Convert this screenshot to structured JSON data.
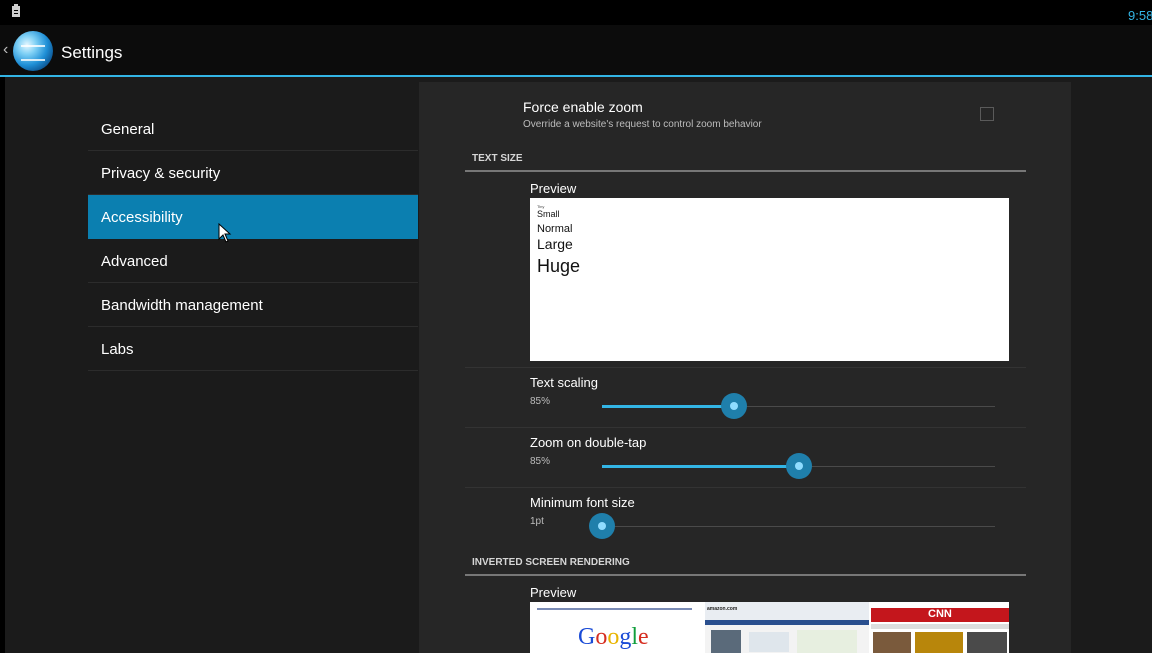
{
  "status_bar": {
    "clock": "9:58"
  },
  "action_bar": {
    "title": "Settings"
  },
  "nav": {
    "items": [
      {
        "label": "General",
        "selected": false
      },
      {
        "label": "Privacy & security",
        "selected": false
      },
      {
        "label": "Accessibility",
        "selected": true
      },
      {
        "label": "Advanced",
        "selected": false
      },
      {
        "label": "Bandwidth management",
        "selected": false
      },
      {
        "label": "Labs",
        "selected": false
      }
    ]
  },
  "force_zoom": {
    "title": "Force enable zoom",
    "summary": "Override a website's request to control zoom behavior",
    "checked": false
  },
  "text_size": {
    "header": "TEXT SIZE",
    "preview_label": "Preview",
    "preview": {
      "tiny": "Tiny",
      "small": "Small",
      "normal": "Normal",
      "large": "Large",
      "huge": "Huge"
    }
  },
  "sliders": {
    "text_scaling": {
      "title": "Text scaling",
      "value": "85%",
      "level": 0.335
    },
    "zoom_double_tap": {
      "title": "Zoom on double-tap",
      "value": "85%",
      "level": 0.5
    },
    "min_font": {
      "title": "Minimum font size",
      "value": "1pt",
      "level": 0.0
    }
  },
  "inverted": {
    "header": "INVERTED SCREEN RENDERING",
    "preview_label": "Preview",
    "google_logo": [
      "G",
      "o",
      "o",
      "g",
      "l",
      "e"
    ],
    "amazon_logo": "amazon.com",
    "cnn_logo": "CNN"
  },
  "colors": {
    "accent": "#33b5e5",
    "selected_nav": "#0b7fb0",
    "thumb": "#1f7fab"
  }
}
